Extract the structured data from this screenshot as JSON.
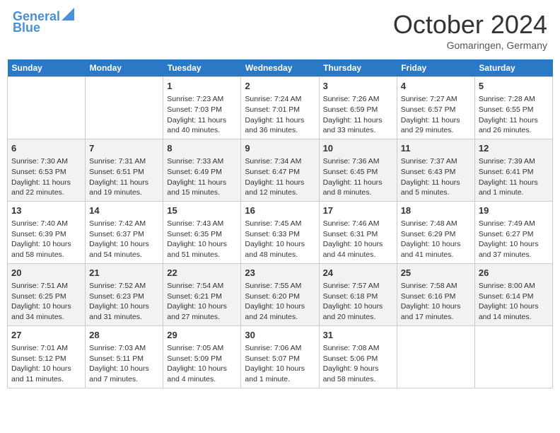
{
  "header": {
    "logo_line1": "General",
    "logo_line2": "Blue",
    "month": "October 2024",
    "location": "Gomaringen, Germany"
  },
  "weekdays": [
    "Sunday",
    "Monday",
    "Tuesday",
    "Wednesday",
    "Thursday",
    "Friday",
    "Saturday"
  ],
  "weeks": [
    [
      {
        "day": "",
        "detail": ""
      },
      {
        "day": "",
        "detail": ""
      },
      {
        "day": "1",
        "detail": "Sunrise: 7:23 AM\nSunset: 7:03 PM\nDaylight: 11 hours and 40 minutes."
      },
      {
        "day": "2",
        "detail": "Sunrise: 7:24 AM\nSunset: 7:01 PM\nDaylight: 11 hours and 36 minutes."
      },
      {
        "day": "3",
        "detail": "Sunrise: 7:26 AM\nSunset: 6:59 PM\nDaylight: 11 hours and 33 minutes."
      },
      {
        "day": "4",
        "detail": "Sunrise: 7:27 AM\nSunset: 6:57 PM\nDaylight: 11 hours and 29 minutes."
      },
      {
        "day": "5",
        "detail": "Sunrise: 7:28 AM\nSunset: 6:55 PM\nDaylight: 11 hours and 26 minutes."
      }
    ],
    [
      {
        "day": "6",
        "detail": "Sunrise: 7:30 AM\nSunset: 6:53 PM\nDaylight: 11 hours and 22 minutes."
      },
      {
        "day": "7",
        "detail": "Sunrise: 7:31 AM\nSunset: 6:51 PM\nDaylight: 11 hours and 19 minutes."
      },
      {
        "day": "8",
        "detail": "Sunrise: 7:33 AM\nSunset: 6:49 PM\nDaylight: 11 hours and 15 minutes."
      },
      {
        "day": "9",
        "detail": "Sunrise: 7:34 AM\nSunset: 6:47 PM\nDaylight: 11 hours and 12 minutes."
      },
      {
        "day": "10",
        "detail": "Sunrise: 7:36 AM\nSunset: 6:45 PM\nDaylight: 11 hours and 8 minutes."
      },
      {
        "day": "11",
        "detail": "Sunrise: 7:37 AM\nSunset: 6:43 PM\nDaylight: 11 hours and 5 minutes."
      },
      {
        "day": "12",
        "detail": "Sunrise: 7:39 AM\nSunset: 6:41 PM\nDaylight: 11 hours and 1 minute."
      }
    ],
    [
      {
        "day": "13",
        "detail": "Sunrise: 7:40 AM\nSunset: 6:39 PM\nDaylight: 10 hours and 58 minutes."
      },
      {
        "day": "14",
        "detail": "Sunrise: 7:42 AM\nSunset: 6:37 PM\nDaylight: 10 hours and 54 minutes."
      },
      {
        "day": "15",
        "detail": "Sunrise: 7:43 AM\nSunset: 6:35 PM\nDaylight: 10 hours and 51 minutes."
      },
      {
        "day": "16",
        "detail": "Sunrise: 7:45 AM\nSunset: 6:33 PM\nDaylight: 10 hours and 48 minutes."
      },
      {
        "day": "17",
        "detail": "Sunrise: 7:46 AM\nSunset: 6:31 PM\nDaylight: 10 hours and 44 minutes."
      },
      {
        "day": "18",
        "detail": "Sunrise: 7:48 AM\nSunset: 6:29 PM\nDaylight: 10 hours and 41 minutes."
      },
      {
        "day": "19",
        "detail": "Sunrise: 7:49 AM\nSunset: 6:27 PM\nDaylight: 10 hours and 37 minutes."
      }
    ],
    [
      {
        "day": "20",
        "detail": "Sunrise: 7:51 AM\nSunset: 6:25 PM\nDaylight: 10 hours and 34 minutes."
      },
      {
        "day": "21",
        "detail": "Sunrise: 7:52 AM\nSunset: 6:23 PM\nDaylight: 10 hours and 31 minutes."
      },
      {
        "day": "22",
        "detail": "Sunrise: 7:54 AM\nSunset: 6:21 PM\nDaylight: 10 hours and 27 minutes."
      },
      {
        "day": "23",
        "detail": "Sunrise: 7:55 AM\nSunset: 6:20 PM\nDaylight: 10 hours and 24 minutes."
      },
      {
        "day": "24",
        "detail": "Sunrise: 7:57 AM\nSunset: 6:18 PM\nDaylight: 10 hours and 20 minutes."
      },
      {
        "day": "25",
        "detail": "Sunrise: 7:58 AM\nSunset: 6:16 PM\nDaylight: 10 hours and 17 minutes."
      },
      {
        "day": "26",
        "detail": "Sunrise: 8:00 AM\nSunset: 6:14 PM\nDaylight: 10 hours and 14 minutes."
      }
    ],
    [
      {
        "day": "27",
        "detail": "Sunrise: 7:01 AM\nSunset: 5:12 PM\nDaylight: 10 hours and 11 minutes."
      },
      {
        "day": "28",
        "detail": "Sunrise: 7:03 AM\nSunset: 5:11 PM\nDaylight: 10 hours and 7 minutes."
      },
      {
        "day": "29",
        "detail": "Sunrise: 7:05 AM\nSunset: 5:09 PM\nDaylight: 10 hours and 4 minutes."
      },
      {
        "day": "30",
        "detail": "Sunrise: 7:06 AM\nSunset: 5:07 PM\nDaylight: 10 hours and 1 minute."
      },
      {
        "day": "31",
        "detail": "Sunrise: 7:08 AM\nSunset: 5:06 PM\nDaylight: 9 hours and 58 minutes."
      },
      {
        "day": "",
        "detail": ""
      },
      {
        "day": "",
        "detail": ""
      }
    ]
  ]
}
